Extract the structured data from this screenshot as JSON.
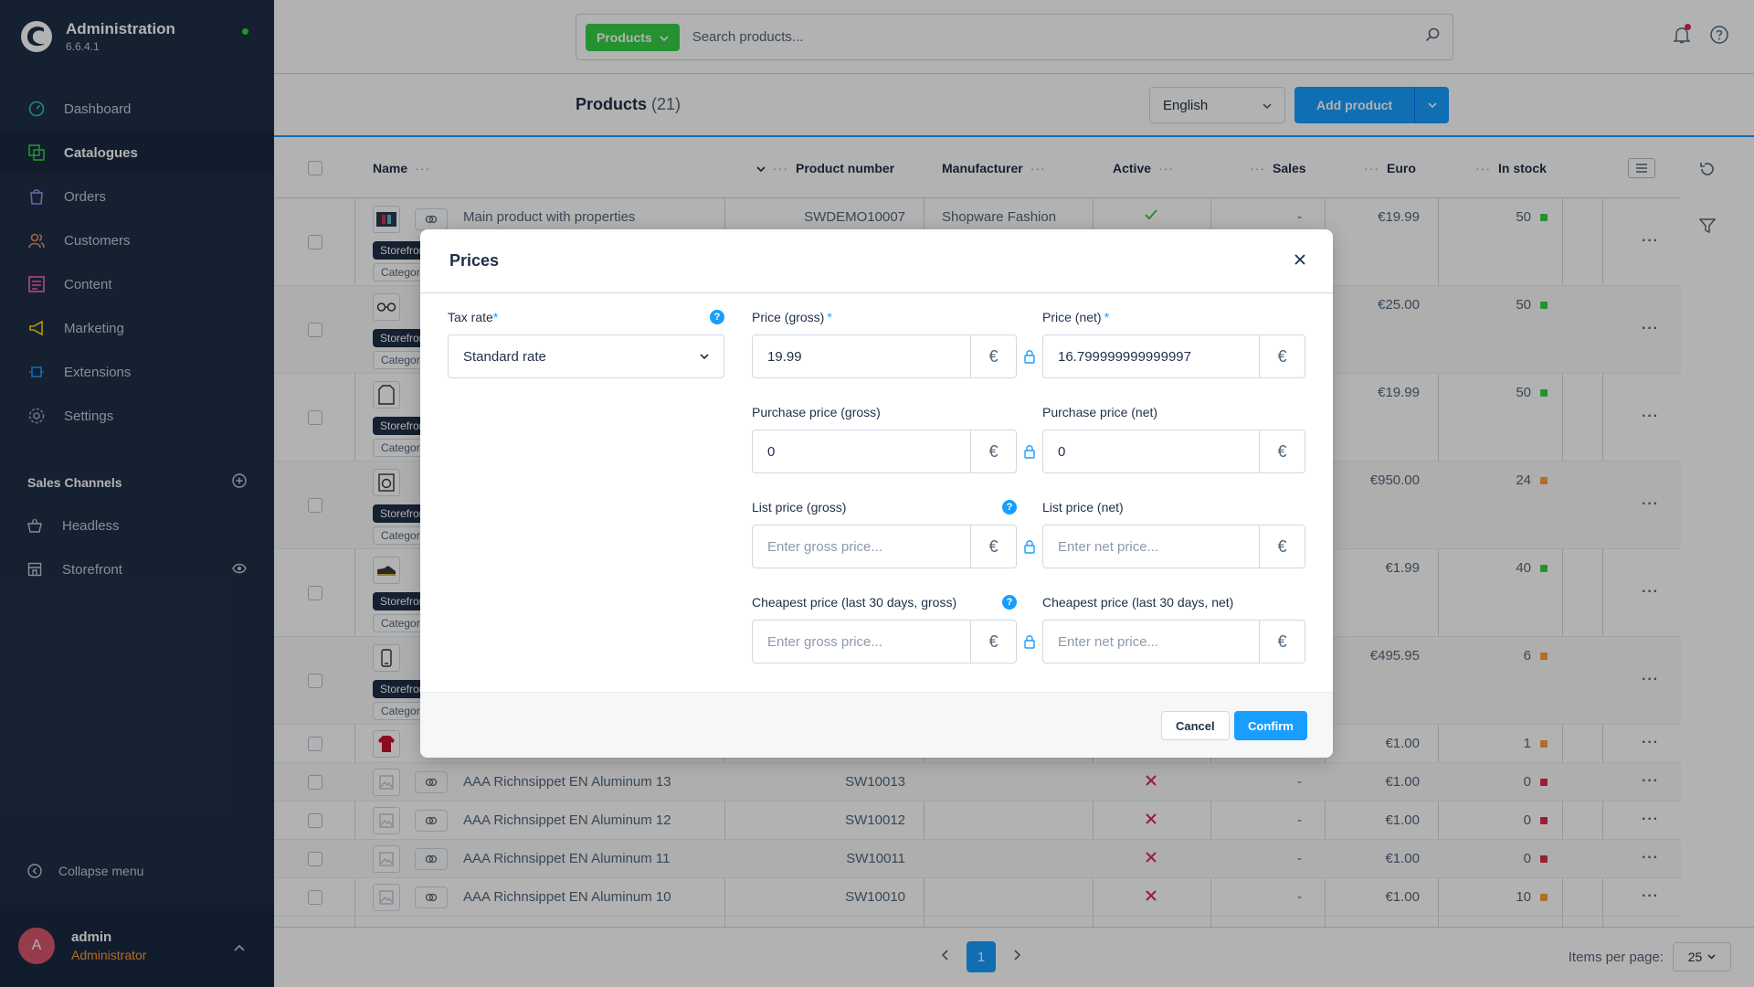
{
  "app": {
    "title": "Administration",
    "version": "6.6.4.1"
  },
  "sidebar": {
    "items": [
      {
        "label": "Dashboard",
        "icon": "dashboard-icon",
        "color": "#22c7c1"
      },
      {
        "label": "Catalogues",
        "icon": "catalogue-icon",
        "color": "#37d046"
      },
      {
        "label": "Orders",
        "icon": "orders-icon",
        "color": "#a092f0"
      },
      {
        "label": "Customers",
        "icon": "customers-icon",
        "color": "#f88962"
      },
      {
        "label": "Content",
        "icon": "content-icon",
        "color": "#ff68b4"
      },
      {
        "label": "Marketing",
        "icon": "marketing-icon",
        "color": "#ffd700"
      },
      {
        "label": "Extensions",
        "icon": "extensions-icon",
        "color": "#189eff"
      },
      {
        "label": "Settings",
        "icon": "settings-icon",
        "color": "#9aa8b5"
      }
    ],
    "sales_channels_title": "Sales Channels",
    "sales_channels": [
      {
        "label": "Headless"
      },
      {
        "label": "Storefront"
      }
    ],
    "collapse_label": "Collapse menu",
    "user": {
      "initial": "A",
      "name": "admin",
      "role": "Administrator"
    }
  },
  "topbar": {
    "search_type": "Products",
    "search_placeholder": "Search products..."
  },
  "smartbar": {
    "title": "Products",
    "count": "(21)",
    "language": "English",
    "add_label": "Add product"
  },
  "grid": {
    "columns": {
      "name": "Name",
      "product_number": "Product number",
      "manufacturer": "Manufacturer",
      "active": "Active",
      "sales": "Sales",
      "price": "Euro",
      "stock": "In stock"
    },
    "tag_storefront": "Storefront",
    "tag_category": "Category",
    "rows": [
      {
        "name": "Main product with properties",
        "number": "SWDEMO10007",
        "manufacturer": "Shopware Fashion",
        "active": "check",
        "sales": "-",
        "price": "€19.99",
        "stock": "50",
        "stock_color": "#37d046",
        "thumb": "jacket-thumb"
      },
      {
        "name": "",
        "number": "",
        "manufacturer": "",
        "active": "",
        "sales": "",
        "price": "€25.00",
        "stock": "50",
        "stock_color": "#37d046",
        "thumb": "glasses-thumb"
      },
      {
        "name": "",
        "number": "",
        "manufacturer": "",
        "active": "",
        "sales": "",
        "price": "€19.99",
        "stock": "50",
        "stock_color": "#37d046",
        "thumb": "shirt-thumb"
      },
      {
        "name": "",
        "number": "",
        "manufacturer": "",
        "active": "",
        "sales": "",
        "price": "€950.00",
        "stock": "24",
        "stock_color": "#ff9d37",
        "thumb": "washer-thumb"
      },
      {
        "name": "",
        "number": "",
        "manufacturer": "",
        "active": "",
        "sales": "",
        "price": "€1.99",
        "stock": "40",
        "stock_color": "#37d046",
        "thumb": "shoe-thumb"
      },
      {
        "name": "",
        "number": "",
        "manufacturer": "",
        "active": "",
        "sales": "",
        "price": "€495.95",
        "stock": "6",
        "stock_color": "#ff9d37",
        "thumb": "phone-thumb"
      },
      {
        "name": "",
        "number": "",
        "manufacturer": "",
        "active": "",
        "sales": "",
        "price": "€1.00",
        "stock": "1",
        "stock_color": "#ff9d37",
        "thumb": "sweater-thumb"
      },
      {
        "name": "AAA Richnsippet EN Aluminum 13",
        "number": "SW10013",
        "manufacturer": "",
        "active": "cross",
        "sales": "-",
        "price": "€1.00",
        "stock": "0",
        "stock_color": "#de294c",
        "thumb": "placeholder-thumb"
      },
      {
        "name": "AAA Richnsippet EN Aluminum 12",
        "number": "SW10012",
        "manufacturer": "",
        "active": "cross",
        "sales": "-",
        "price": "€1.00",
        "stock": "0",
        "stock_color": "#de294c",
        "thumb": "placeholder-thumb"
      },
      {
        "name": "AAA Richnsippet EN Aluminum 11",
        "number": "SW10011",
        "manufacturer": "",
        "active": "cross",
        "sales": "-",
        "price": "€1.00",
        "stock": "0",
        "stock_color": "#de294c",
        "thumb": "placeholder-thumb"
      },
      {
        "name": "AAA Richnsippet EN Aluminum 10",
        "number": "SW10010",
        "manufacturer": "",
        "active": "cross",
        "sales": "-",
        "price": "€1.00",
        "stock": "10",
        "stock_color": "#ff9d37",
        "thumb": "placeholder-thumb"
      }
    ]
  },
  "pagination": {
    "current": "1",
    "items_per_page_label": "Items per page:",
    "items_per_page": "25"
  },
  "modal": {
    "title": "Prices",
    "tax_rate_label": "Tax rate",
    "tax_rate_value": "Standard rate",
    "price_gross_label": "Price (gross)",
    "price_gross_value": "19.99",
    "price_net_label": "Price (net)",
    "price_net_value": "16.799999999999997",
    "purchase_gross_label": "Purchase price (gross)",
    "purchase_gross_value": "0",
    "purchase_net_label": "Purchase price (net)",
    "purchase_net_value": "0",
    "list_gross_label": "List price (gross)",
    "list_net_label": "List price (net)",
    "cheapest_gross_label": "Cheapest price (last 30 days, gross)",
    "cheapest_net_label": "Cheapest price (last 30 days, net)",
    "gross_placeholder": "Enter gross price...",
    "net_placeholder": "Enter net price...",
    "currency_symbol": "€",
    "required_mark": "*",
    "help_mark": "?",
    "cancel_label": "Cancel",
    "confirm_label": "Confirm"
  }
}
